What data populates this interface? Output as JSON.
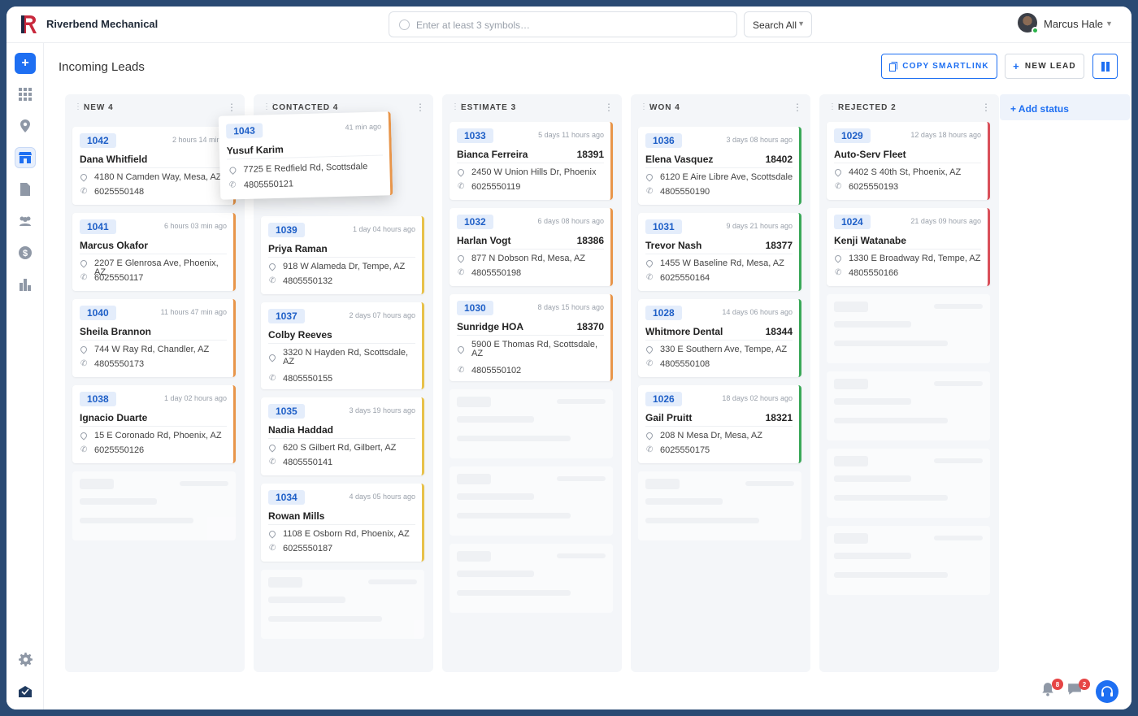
{
  "app": {
    "brand": "Riverbend Mechanical"
  },
  "search": {
    "placeholder": "Enter at least 3 symbols…",
    "scope": "Search All"
  },
  "user": {
    "name": "Marcus Hale"
  },
  "page": {
    "title": "Incoming Leads"
  },
  "actions": {
    "copy_smartlink": "COPY SMARTLINK",
    "new_lead": "NEW LEAD"
  },
  "add_status": "+ Add status",
  "colors": {
    "accent": "#1e6ff2",
    "new": "#e8954a",
    "contacted": "#e8c14a",
    "estimate": "#e8954a",
    "won": "#3aa858",
    "rejected": "#d9505a"
  },
  "dragging_card": {
    "id": "1043",
    "time": "41 min ago",
    "name": "Yusuf Karim",
    "address": "7725 E Redfield Rd, Scottsdale",
    "phone": "4805550121"
  },
  "columns": [
    {
      "title": "NEW 4",
      "cards": [
        {
          "id": "1042",
          "time": "2 hours 14 min a",
          "name": "Dana Whitfield",
          "amount": "",
          "address": "4180 N Camden Way, Mesa, AZ",
          "phone": "6025550148"
        },
        {
          "id": "1041",
          "time": "6 hours 03 min ago",
          "name": "Marcus Okafor",
          "amount": "",
          "address": "2207 E Glenrosa Ave, Phoenix, AZ",
          "phone": "6025550117"
        },
        {
          "id": "1040",
          "time": "11 hours 47 min ago",
          "name": "Sheila Brannon",
          "amount": "",
          "address": "744 W Ray Rd, Chandler, AZ",
          "phone": "4805550173"
        },
        {
          "id": "1038",
          "time": "1 day 02 hours ago",
          "name": "Ignacio Duarte",
          "amount": "",
          "address": "15 E Coronado Rd, Phoenix, AZ",
          "phone": "6025550126"
        }
      ]
    },
    {
      "title": "CONTACTED 4",
      "cards": [
        {
          "id": "1039",
          "time": "1 day 04 hours ago",
          "name": "Priya Raman",
          "amount": "",
          "address": "918 W Alameda Dr, Tempe, AZ",
          "phone": "4805550132"
        },
        {
          "id": "1037",
          "time": "2 days 07 hours ago",
          "name": "Colby Reeves",
          "amount": "",
          "address": "3320 N Hayden Rd, Scottsdale, AZ",
          "phone": "4805550155"
        },
        {
          "id": "1035",
          "time": "3 days 19 hours ago",
          "name": "Nadia Haddad",
          "amount": "",
          "address": "620 S Gilbert Rd, Gilbert, AZ",
          "phone": "4805550141"
        },
        {
          "id": "1034",
          "time": "4 days 05 hours ago",
          "name": "Rowan Mills",
          "amount": "",
          "address": "1108 E Osborn Rd, Phoenix, AZ",
          "phone": "6025550187"
        }
      ]
    },
    {
      "title": "ESTIMATE 3",
      "cards": [
        {
          "id": "1033",
          "time": "5 days 11 hours ago",
          "name": "Bianca Ferreira",
          "amount": "18391",
          "address": "2450 W Union Hills Dr, Phoenix",
          "phone": "6025550119"
        },
        {
          "id": "1032",
          "time": "6 days 08 hours ago",
          "name": "Harlan Vogt",
          "amount": "18386",
          "address": "877 N Dobson Rd, Mesa, AZ",
          "phone": "4805550198"
        },
        {
          "id": "1030",
          "time": "8 days 15 hours ago",
          "name": "Sunridge HOA",
          "amount": "18370",
          "address": "5900 E Thomas Rd, Scottsdale, AZ",
          "phone": "4805550102"
        }
      ]
    },
    {
      "title": "WON 4",
      "cards": [
        {
          "id": "1036",
          "time": "3 days 08 hours ago",
          "name": "Elena Vasquez",
          "amount": "18402",
          "address": "6120 E Aire Libre Ave, Scottsdale",
          "phone": "4805550190"
        },
        {
          "id": "1031",
          "time": "9 days 21 hours ago",
          "name": "Trevor Nash",
          "amount": "18377",
          "address": "1455 W Baseline Rd, Mesa, AZ",
          "phone": "6025550164"
        },
        {
          "id": "1028",
          "time": "14 days 06 hours ago",
          "name": "Whitmore Dental",
          "amount": "18344",
          "address": "330 E Southern Ave, Tempe, AZ",
          "phone": "4805550108"
        },
        {
          "id": "1026",
          "time": "18 days 02 hours ago",
          "name": "Gail Pruitt",
          "amount": "18321",
          "address": "208 N Mesa Dr, Mesa, AZ",
          "phone": "6025550175"
        }
      ]
    },
    {
      "title": "REJECTED 2",
      "cards": [
        {
          "id": "1029",
          "time": "12 days 18 hours ago",
          "name": "Auto-Serv Fleet",
          "amount": "",
          "address": "4402 S 40th St, Phoenix, AZ",
          "phone": "6025550193"
        },
        {
          "id": "1024",
          "time": "21 days 09 hours ago",
          "name": "Kenji Watanabe",
          "amount": "",
          "address": "1330 E Broadway Rd, Tempe, AZ",
          "phone": "4805550166"
        }
      ]
    }
  ],
  "notifications": {
    "bell_count": "8",
    "chat_count": "2"
  }
}
